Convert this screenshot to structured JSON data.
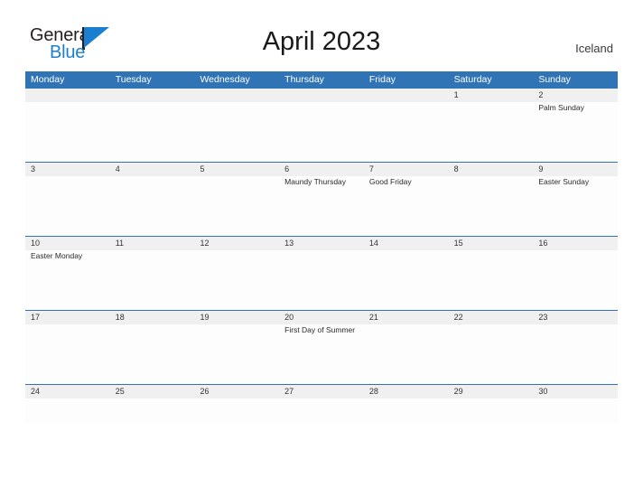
{
  "logo": {
    "word_one": "General",
    "word_two": "Blue",
    "flag_icon": "flag-triangle-icon",
    "dark_color": "#231f20",
    "blue_color": "#1b7fd1"
  },
  "header": {
    "title": "April 2023",
    "region": "Iceland"
  },
  "colors": {
    "header_blue": "#3174b5",
    "number_band": "#f0f0f0",
    "cell_background": "#fdfdfd",
    "text": "#333333"
  },
  "calendar": {
    "weekdays": [
      "Monday",
      "Tuesday",
      "Wednesday",
      "Thursday",
      "Friday",
      "Saturday",
      "Sunday"
    ],
    "weeks": [
      {
        "days": [
          {
            "number": "",
            "event": ""
          },
          {
            "number": "",
            "event": ""
          },
          {
            "number": "",
            "event": ""
          },
          {
            "number": "",
            "event": ""
          },
          {
            "number": "",
            "event": ""
          },
          {
            "number": "1",
            "event": ""
          },
          {
            "number": "2",
            "event": "Palm Sunday"
          }
        ]
      },
      {
        "days": [
          {
            "number": "3",
            "event": ""
          },
          {
            "number": "4",
            "event": ""
          },
          {
            "number": "5",
            "event": ""
          },
          {
            "number": "6",
            "event": "Maundy Thursday"
          },
          {
            "number": "7",
            "event": "Good Friday"
          },
          {
            "number": "8",
            "event": ""
          },
          {
            "number": "9",
            "event": "Easter Sunday"
          }
        ]
      },
      {
        "days": [
          {
            "number": "10",
            "event": "Easter Monday"
          },
          {
            "number": "11",
            "event": ""
          },
          {
            "number": "12",
            "event": ""
          },
          {
            "number": "13",
            "event": ""
          },
          {
            "number": "14",
            "event": ""
          },
          {
            "number": "15",
            "event": ""
          },
          {
            "number": "16",
            "event": ""
          }
        ]
      },
      {
        "days": [
          {
            "number": "17",
            "event": ""
          },
          {
            "number": "18",
            "event": ""
          },
          {
            "number": "19",
            "event": ""
          },
          {
            "number": "20",
            "event": "First Day of Summer"
          },
          {
            "number": "21",
            "event": ""
          },
          {
            "number": "22",
            "event": ""
          },
          {
            "number": "23",
            "event": ""
          }
        ]
      },
      {
        "days": [
          {
            "number": "24",
            "event": ""
          },
          {
            "number": "25",
            "event": ""
          },
          {
            "number": "26",
            "event": ""
          },
          {
            "number": "27",
            "event": ""
          },
          {
            "number": "28",
            "event": ""
          },
          {
            "number": "29",
            "event": ""
          },
          {
            "number": "30",
            "event": ""
          }
        ]
      }
    ]
  }
}
